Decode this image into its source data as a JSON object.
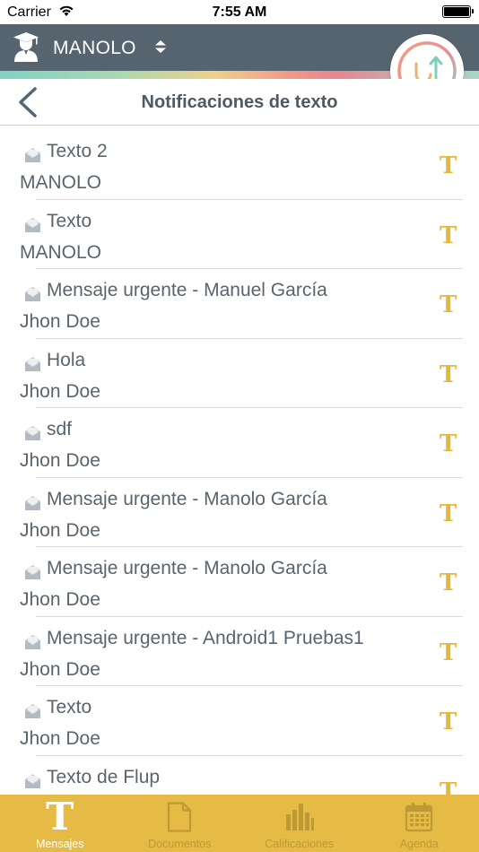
{
  "status_bar": {
    "carrier": "Carrier",
    "time": "7:55 AM"
  },
  "header": {
    "user_name": "MANOLO"
  },
  "nav": {
    "title": "Notificaciones de texto"
  },
  "messages": [
    {
      "title": "Texto 2",
      "sender": "MANOLO",
      "type": "T"
    },
    {
      "title": "Texto",
      "sender": "MANOLO",
      "type": "T"
    },
    {
      "title": "Mensaje urgente - Manuel García",
      "sender": "Jhon Doe",
      "type": "T"
    },
    {
      "title": "Hola",
      "sender": "Jhon Doe",
      "type": "T"
    },
    {
      "title": "sdf",
      "sender": "Jhon Doe",
      "type": "T"
    },
    {
      "title": "Mensaje urgente - Manolo García",
      "sender": "Jhon Doe",
      "type": "T"
    },
    {
      "title": "Mensaje urgente - Manolo García",
      "sender": "Jhon Doe",
      "type": "T"
    },
    {
      "title": "Mensaje urgente - Android1 Pruebas1",
      "sender": "Jhon Doe",
      "type": "T"
    },
    {
      "title": "Texto",
      "sender": "Jhon Doe",
      "type": "T"
    },
    {
      "title": "Texto de Flup",
      "sender": "",
      "type": "T"
    }
  ],
  "tabs": [
    {
      "label": "Mensajes",
      "icon": "text-t-icon",
      "active": true
    },
    {
      "label": "Documentos",
      "icon": "document-icon",
      "active": false
    },
    {
      "label": "Calificaciones",
      "icon": "bar-chart-icon",
      "active": false
    },
    {
      "label": "Agenda",
      "icon": "calendar-icon",
      "active": false
    }
  ],
  "colors": {
    "header_bg": "#566470",
    "tab_bar_bg": "#e5ba45",
    "accent_gold": "#e3b93c",
    "text": "#5a646c"
  }
}
